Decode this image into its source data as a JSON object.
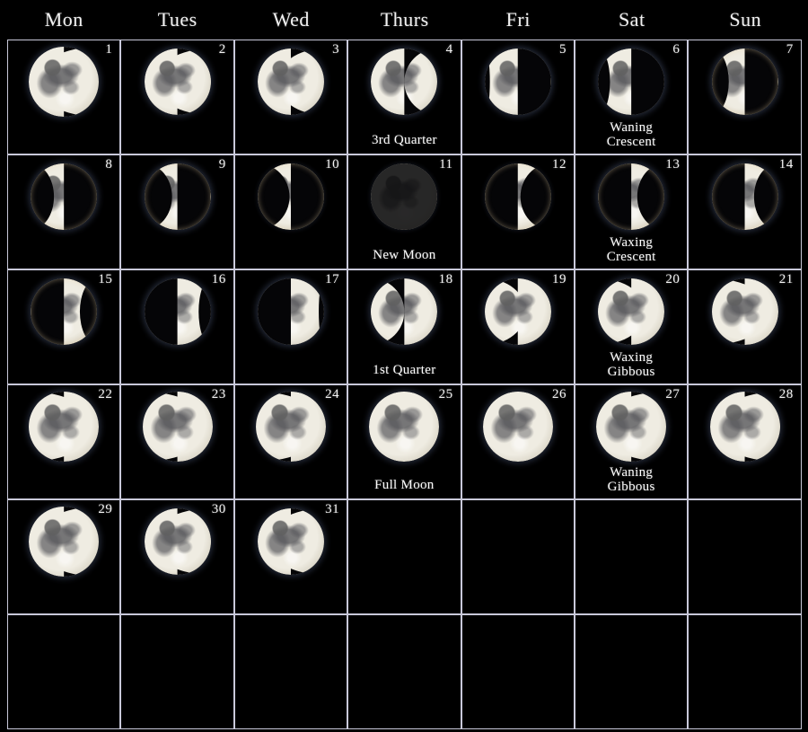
{
  "calendar": {
    "weekday_headers": [
      "Mon",
      "Tues",
      "Wed",
      "Thurs",
      "Fri",
      "Sat",
      "Sun"
    ],
    "grid_rows": 6,
    "grid_cols": 7,
    "background_color": "#000000",
    "rule_color_top": "#d8d8e4",
    "rule_color_bottom": "#3c4c50",
    "text_color": "#ffffff",
    "days": [
      {
        "day": "1",
        "col": 1,
        "row": 1,
        "phase": "waning gibbous",
        "illumination": 0.93,
        "lit_side": "left",
        "label": ""
      },
      {
        "day": "2",
        "col": 2,
        "row": 1,
        "phase": "waning gibbous",
        "illumination": 0.84,
        "lit_side": "left",
        "label": ""
      },
      {
        "day": "3",
        "col": 3,
        "row": 1,
        "phase": "waning gibbous",
        "illumination": 0.71,
        "lit_side": "left",
        "label": ""
      },
      {
        "day": "4",
        "col": 4,
        "row": 1,
        "phase": "third quarter",
        "illumination": 0.5,
        "lit_side": "left",
        "label": "3rd Quarter"
      },
      {
        "day": "5",
        "col": 5,
        "row": 1,
        "phase": "waning crescent",
        "illumination": 0.42,
        "lit_side": "left",
        "label": ""
      },
      {
        "day": "6",
        "col": 6,
        "row": 1,
        "phase": "waning crescent",
        "illumination": 0.32,
        "lit_side": "left",
        "label": "Waning\nCrescent"
      },
      {
        "day": "7",
        "col": 7,
        "row": 1,
        "phase": "waning crescent",
        "illumination": 0.24,
        "lit_side": "left",
        "label": ""
      },
      {
        "day": "8",
        "col": 1,
        "row": 2,
        "phase": "waning crescent",
        "illumination": 0.15,
        "lit_side": "left",
        "label": ""
      },
      {
        "day": "9",
        "col": 2,
        "row": 2,
        "phase": "waning crescent",
        "illumination": 0.08,
        "lit_side": "left",
        "label": ""
      },
      {
        "day": "10",
        "col": 3,
        "row": 2,
        "phase": "waning crescent",
        "illumination": 0.02,
        "lit_side": "left",
        "label": ""
      },
      {
        "day": "11",
        "col": 4,
        "row": 2,
        "phase": "new moon",
        "illumination": 0.0,
        "lit_side": "none",
        "label": "New Moon"
      },
      {
        "day": "12",
        "col": 5,
        "row": 2,
        "phase": "waxing crescent",
        "illumination": 0.04,
        "lit_side": "right",
        "label": ""
      },
      {
        "day": "13",
        "col": 6,
        "row": 2,
        "phase": "waxing crescent",
        "illumination": 0.09,
        "lit_side": "right",
        "label": "Waxing\nCrescent"
      },
      {
        "day": "14",
        "col": 7,
        "row": 2,
        "phase": "waxing crescent",
        "illumination": 0.14,
        "lit_side": "right",
        "label": ""
      },
      {
        "day": "15",
        "col": 1,
        "row": 3,
        "phase": "waxing crescent",
        "illumination": 0.24,
        "lit_side": "right",
        "label": ""
      },
      {
        "day": "16",
        "col": 2,
        "row": 3,
        "phase": "waxing crescent",
        "illumination": 0.32,
        "lit_side": "right",
        "label": ""
      },
      {
        "day": "17",
        "col": 3,
        "row": 3,
        "phase": "waxing crescent",
        "illumination": 0.42,
        "lit_side": "right",
        "label": ""
      },
      {
        "day": "18",
        "col": 4,
        "row": 3,
        "phase": "first quarter",
        "illumination": 0.5,
        "lit_side": "right",
        "label": "1st Quarter"
      },
      {
        "day": "19",
        "col": 5,
        "row": 3,
        "phase": "waxing gibbous",
        "illumination": 0.62,
        "lit_side": "right",
        "label": ""
      },
      {
        "day": "20",
        "col": 6,
        "row": 3,
        "phase": "waxing gibbous",
        "illumination": 0.72,
        "lit_side": "right",
        "label": "Waxing\nGibbous"
      },
      {
        "day": "21",
        "col": 7,
        "row": 3,
        "phase": "waxing gibbous",
        "illumination": 0.88,
        "lit_side": "right",
        "label": ""
      },
      {
        "day": "22",
        "col": 1,
        "row": 4,
        "phase": "waxing gibbous",
        "illumination": 0.95,
        "lit_side": "right",
        "label": ""
      },
      {
        "day": "23",
        "col": 2,
        "row": 4,
        "phase": "waxing gibbous",
        "illumination": 0.98,
        "lit_side": "right",
        "label": ""
      },
      {
        "day": "24",
        "col": 3,
        "row": 4,
        "phase": "waxing gibbous",
        "illumination": 0.99,
        "lit_side": "right",
        "label": ""
      },
      {
        "day": "25",
        "col": 4,
        "row": 4,
        "phase": "full moon",
        "illumination": 1.0,
        "lit_side": "none",
        "label": "Full Moon"
      },
      {
        "day": "26",
        "col": 5,
        "row": 4,
        "phase": "full moon",
        "illumination": 1.0,
        "lit_side": "none",
        "label": ""
      },
      {
        "day": "27",
        "col": 6,
        "row": 4,
        "phase": "waning gibbous",
        "illumination": 0.99,
        "lit_side": "left",
        "label": "Waning\nGibbous"
      },
      {
        "day": "28",
        "col": 7,
        "row": 4,
        "phase": "waning gibbous",
        "illumination": 0.97,
        "lit_side": "left",
        "label": ""
      },
      {
        "day": "29",
        "col": 1,
        "row": 5,
        "phase": "waning gibbous",
        "illumination": 0.95,
        "lit_side": "left",
        "label": ""
      },
      {
        "day": "30",
        "col": 2,
        "row": 5,
        "phase": "waning gibbous",
        "illumination": 0.9,
        "lit_side": "left",
        "label": ""
      },
      {
        "day": "31",
        "col": 3,
        "row": 5,
        "phase": "waning gibbous",
        "illumination": 0.86,
        "lit_side": "left",
        "label": ""
      }
    ],
    "phase_legend": [
      "3rd Quarter",
      "Waning Crescent",
      "New Moon",
      "Waxing Crescent",
      "1st Quarter",
      "Waxing Gibbous",
      "Full Moon",
      "Waning Gibbous"
    ]
  }
}
